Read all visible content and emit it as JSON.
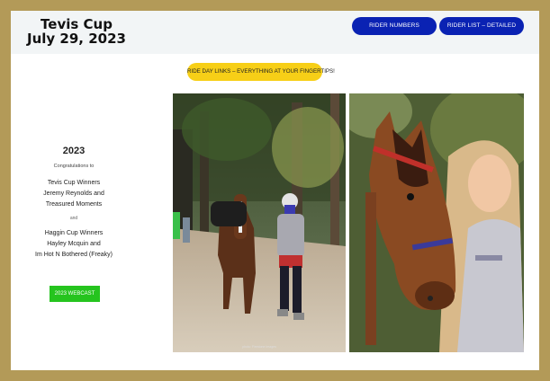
{
  "header": {
    "title_line1": "Tevis Cup",
    "title_line2": "July 29, 2023",
    "rider_numbers_label": "RIDER NUMBERS",
    "rider_list_label": "RIDER LIST – DETAILED"
  },
  "ride_day_label": "RIDE DAY LINKS – EVERYTHING AT YOUR FINGERTIPS!",
  "winners": {
    "year": "2023",
    "congrats": "Congratulations to",
    "tevis_heading": "Tevis Cup Winners",
    "tevis_line1": "Jeremy Reynolds and",
    "tevis_line2": "Treasured Moments",
    "and_text": "and",
    "haggin_heading": "Haggin Cup Winners",
    "haggin_line1": "Hayley Mcquin and",
    "haggin_line2": "Im Hot N Bothered (Freaky)",
    "webcast_label": "2023 WEBCAST"
  },
  "photos": {
    "left_caption": "photo: Firestone Images"
  },
  "colors": {
    "frame": "#b39a58",
    "header_bg": "#f2f5f6",
    "nav_button": "#0a22b3",
    "ride_day_button": "#f7cf17",
    "webcast_button": "#25c41e"
  }
}
